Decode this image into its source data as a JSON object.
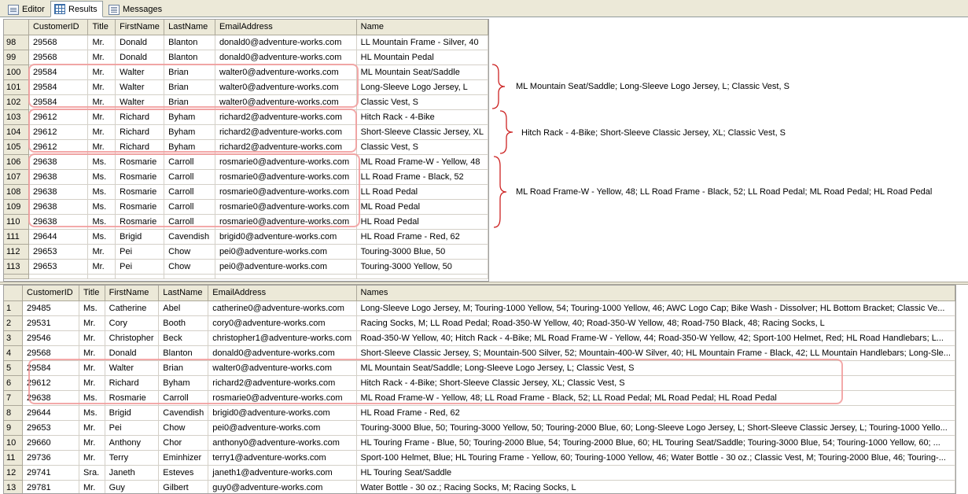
{
  "tabs": [
    {
      "label": "Editor",
      "icon": "editor-icon"
    },
    {
      "label": "Results",
      "icon": "results-grid-icon"
    },
    {
      "label": "Messages",
      "icon": "messages-icon"
    }
  ],
  "top_grid": {
    "columns": [
      "",
      "CustomerID",
      "Title",
      "FirstName",
      "LastName",
      "EmailAddress",
      "Name"
    ],
    "rows": [
      [
        "98",
        "29568",
        "Mr.",
        "Donald",
        "Blanton",
        "donald0@adventure-works.com",
        "LL Mountain Frame - Silver, 40"
      ],
      [
        "99",
        "29568",
        "Mr.",
        "Donald",
        "Blanton",
        "donald0@adventure-works.com",
        "HL Mountain Pedal"
      ],
      [
        "100",
        "29584",
        "Mr.",
        "Walter",
        "Brian",
        "walter0@adventure-works.com",
        "ML Mountain Seat/Saddle"
      ],
      [
        "101",
        "29584",
        "Mr.",
        "Walter",
        "Brian",
        "walter0@adventure-works.com",
        "Long-Sleeve Logo Jersey, L"
      ],
      [
        "102",
        "29584",
        "Mr.",
        "Walter",
        "Brian",
        "walter0@adventure-works.com",
        "Classic Vest, S"
      ],
      [
        "103",
        "29612",
        "Mr.",
        "Richard",
        "Byham",
        "richard2@adventure-works.com",
        "Hitch Rack - 4-Bike"
      ],
      [
        "104",
        "29612",
        "Mr.",
        "Richard",
        "Byham",
        "richard2@adventure-works.com",
        "Short-Sleeve Classic Jersey, XL"
      ],
      [
        "105",
        "29612",
        "Mr.",
        "Richard",
        "Byham",
        "richard2@adventure-works.com",
        "Classic Vest, S"
      ],
      [
        "106",
        "29638",
        "Ms.",
        "Rosmarie",
        "Carroll",
        "rosmarie0@adventure-works.com",
        "ML Road Frame-W - Yellow, 48"
      ],
      [
        "107",
        "29638",
        "Ms.",
        "Rosmarie",
        "Carroll",
        "rosmarie0@adventure-works.com",
        "LL Road Frame - Black, 52"
      ],
      [
        "108",
        "29638",
        "Ms.",
        "Rosmarie",
        "Carroll",
        "rosmarie0@adventure-works.com",
        "LL Road Pedal"
      ],
      [
        "109",
        "29638",
        "Ms.",
        "Rosmarie",
        "Carroll",
        "rosmarie0@adventure-works.com",
        "ML Road Pedal"
      ],
      [
        "110",
        "29638",
        "Ms.",
        "Rosmarie",
        "Carroll",
        "rosmarie0@adventure-works.com",
        "HL Road Pedal"
      ],
      [
        "111",
        "29644",
        "Ms.",
        "Brigid",
        "Cavendish",
        "brigid0@adventure-works.com",
        "HL Road Frame - Red, 62"
      ],
      [
        "112",
        "29653",
        "Mr.",
        "Pei",
        "Chow",
        "pei0@adventure-works.com",
        "Touring-3000 Blue, 50"
      ],
      [
        "113",
        "29653",
        "Mr.",
        "Pei",
        "Chow",
        "pei0@adventure-works.com",
        "Touring-3000 Yellow, 50"
      ]
    ]
  },
  "annotations": [
    "ML Mountain Seat/Saddle; Long-Sleeve Logo Jersey, L; Classic Vest, S",
    "Hitch Rack - 4-Bike; Short-Sleeve Classic Jersey, XL; Classic Vest, S",
    "ML Road Frame-W - Yellow, 48; LL Road Frame - Black, 52; LL Road Pedal; ML Road Pedal; HL Road Pedal"
  ],
  "bottom_grid": {
    "columns": [
      "",
      "CustomerID",
      "Title",
      "FirstName",
      "LastName",
      "EmailAddress",
      "Names"
    ],
    "rows": [
      [
        "1",
        "29485",
        "Ms.",
        "Catherine",
        "Abel",
        "catherine0@adventure-works.com",
        "Long-Sleeve Logo Jersey, M; Touring-1000 Yellow, 54; Touring-1000 Yellow, 46; AWC Logo Cap; Bike Wash - Dissolver; HL Bottom Bracket; Classic Ve..."
      ],
      [
        "2",
        "29531",
        "Mr.",
        "Cory",
        "Booth",
        "cory0@adventure-works.com",
        "Racing Socks, M; LL Road Pedal; Road-350-W Yellow, 40; Road-350-W Yellow, 48; Road-750 Black, 48; Racing Socks, L"
      ],
      [
        "3",
        "29546",
        "Mr.",
        "Christopher",
        "Beck",
        "christopher1@adventure-works.com",
        "Road-350-W Yellow, 40; Hitch Rack - 4-Bike; ML Road Frame-W - Yellow, 44; Road-350-W Yellow, 42; Sport-100 Helmet, Red; HL Road Handlebars; L..."
      ],
      [
        "4",
        "29568",
        "Mr.",
        "Donald",
        "Blanton",
        "donald0@adventure-works.com",
        "Short-Sleeve Classic Jersey, S; Mountain-500 Silver, 52; Mountain-400-W Silver, 40; HL Mountain Frame - Black, 42; LL Mountain Handlebars; Long-Sle..."
      ],
      [
        "5",
        "29584",
        "Mr.",
        "Walter",
        "Brian",
        "walter0@adventure-works.com",
        "ML Mountain Seat/Saddle; Long-Sleeve Logo Jersey, L; Classic Vest, S"
      ],
      [
        "6",
        "29612",
        "Mr.",
        "Richard",
        "Byham",
        "richard2@adventure-works.com",
        "Hitch Rack - 4-Bike; Short-Sleeve Classic Jersey, XL; Classic Vest, S"
      ],
      [
        "7",
        "29638",
        "Ms.",
        "Rosmarie",
        "Carroll",
        "rosmarie0@adventure-works.com",
        "ML Road Frame-W - Yellow, 48; LL Road Frame - Black, 52; LL Road Pedal; ML Road Pedal; HL Road Pedal"
      ],
      [
        "8",
        "29644",
        "Ms.",
        "Brigid",
        "Cavendish",
        "brigid0@adventure-works.com",
        "HL Road Frame - Red, 62"
      ],
      [
        "9",
        "29653",
        "Mr.",
        "Pei",
        "Chow",
        "pei0@adventure-works.com",
        "Touring-3000 Blue, 50; Touring-3000 Yellow, 50; Touring-2000 Blue, 60; Long-Sleeve Logo Jersey, L; Short-Sleeve Classic Jersey, L; Touring-1000 Yello..."
      ],
      [
        "10",
        "29660",
        "Mr.",
        "Anthony",
        "Chor",
        "anthony0@adventure-works.com",
        "HL Touring Frame - Blue, 50; Touring-2000 Blue, 54; Touring-2000 Blue, 60; HL Touring Seat/Saddle; Touring-3000 Blue, 54; Touring-1000 Yellow, 60; ..."
      ],
      [
        "11",
        "29736",
        "Mr.",
        "Terry",
        "Eminhizer",
        "terry1@adventure-works.com",
        "Sport-100 Helmet, Blue; HL Touring Frame - Yellow, 60; Touring-1000 Yellow, 46; Water Bottle - 30 oz.; Classic Vest, M; Touring-2000 Blue, 46; Touring-..."
      ],
      [
        "12",
        "29741",
        "Sra.",
        "Janeth",
        "Esteves",
        "janeth1@adventure-works.com",
        "HL Touring Seat/Saddle"
      ],
      [
        "13",
        "29781",
        "Mr.",
        "Guy",
        "Gilbert",
        "guy0@adventure-works.com",
        "Water Bottle - 30 oz.; Racing Socks, M; Racing Socks, L"
      ]
    ]
  },
  "colors": {
    "highlight": "#f19a9a",
    "brace": "#cc2222",
    "header_bg": "#ece9d8"
  }
}
